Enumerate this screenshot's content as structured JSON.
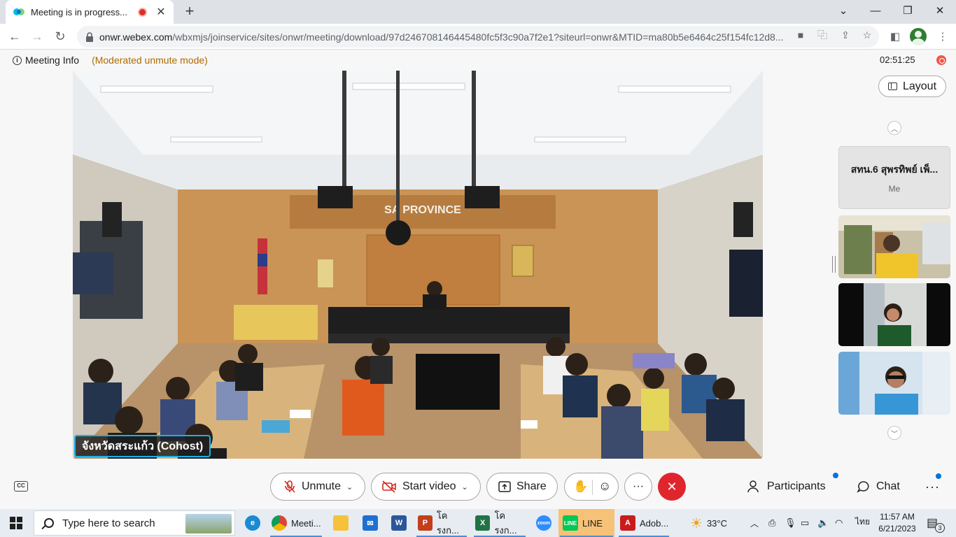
{
  "browser": {
    "tab_title": "Meeting is in progress...",
    "url_host": "onwr.webex.com",
    "url_rest": "/wbxmjs/joinservice/sites/onwr/meeting/download/97d246708146445480fc5f3c90a7f2e1?siteurl=onwr&MTID=ma80b5e6464c25f154fc12d8..."
  },
  "meeting": {
    "info_label": "Meeting Info",
    "mode_label": "(Moderated unmute mode)",
    "timer": "02:51:25",
    "layout_label": "Layout",
    "active_speaker_name": "จังหวัดสระแก้ว (Cohost)",
    "room_sign": "SA  PROVINCE",
    "self_tile": {
      "name": "สทน.6 สุพรทิพย์ เพ็...",
      "label": "Me"
    }
  },
  "controls": {
    "unmute_label": "Unmute",
    "video_label": "Start video",
    "share_label": "Share",
    "participants_label": "Participants",
    "chat_label": "Chat",
    "more_label": "···",
    "captions_label": "CC"
  },
  "taskbar": {
    "search_placeholder": "Type here to search",
    "apps": [
      {
        "label": "Meeti..."
      },
      {
        "label": "โครงก..."
      },
      {
        "label": "โครงก..."
      },
      {
        "label": "LINE"
      },
      {
        "label": "Adob..."
      }
    ],
    "weather": "33°C",
    "language": "ไทย",
    "time": "11:57 AM",
    "date": "6/21/2023",
    "notification_count": "3"
  },
  "colors": {
    "end_call": "#e0262d",
    "mode_text": "#b06a00",
    "name_tag_border": "#1ab0e8",
    "notification_dot": "#0074d9"
  }
}
